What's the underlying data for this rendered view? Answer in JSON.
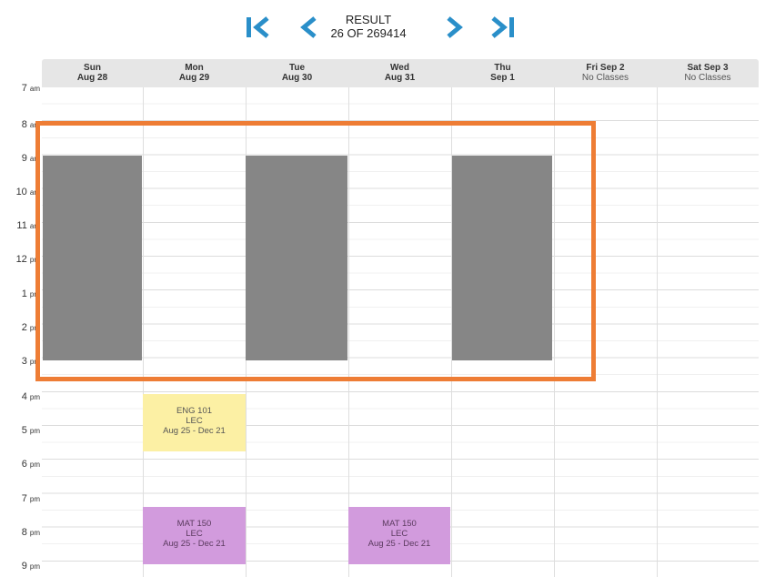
{
  "nav": {
    "first_label": "First result",
    "prev_label": "Previous result",
    "next_label": "Next result",
    "last_label": "Last result",
    "result_title": "RESULT",
    "result_count": "26 OF 269414",
    "icon_color": "#2a8fc9"
  },
  "days": [
    {
      "name": "Sun",
      "date": "Aug 28"
    },
    {
      "name": "Mon",
      "date": "Aug 29"
    },
    {
      "name": "Tue",
      "date": "Aug 30"
    },
    {
      "name": "Wed",
      "date": "Aug 31"
    },
    {
      "name": "Thu",
      "date": "Sep 1"
    },
    {
      "name": "Fri Sep 2",
      "date": "No Classes"
    },
    {
      "name": "Sat Sep 3",
      "date": "No Classes"
    }
  ],
  "times": [
    {
      "h": "7",
      "ap": "am"
    },
    {
      "h": "8",
      "ap": "am"
    },
    {
      "h": "9",
      "ap": "am"
    },
    {
      "h": "10",
      "ap": "am"
    },
    {
      "h": "11",
      "ap": "am"
    },
    {
      "h": "12",
      "ap": "pm"
    },
    {
      "h": "1",
      "ap": "pm"
    },
    {
      "h": "2",
      "ap": "pm"
    },
    {
      "h": "3",
      "ap": "pm"
    },
    {
      "h": "4",
      "ap": "pm"
    },
    {
      "h": "5",
      "ap": "pm"
    },
    {
      "h": "6",
      "ap": "pm"
    },
    {
      "h": "7",
      "ap": "pm"
    },
    {
      "h": "8",
      "ap": "pm"
    },
    {
      "h": "9",
      "ap": "pm"
    }
  ],
  "blocked": [
    {
      "day": "Sun",
      "start": "9:00 am",
      "end": "3:00 pm"
    },
    {
      "day": "Tue",
      "start": "9:00 am",
      "end": "3:00 pm"
    },
    {
      "day": "Thu",
      "start": "9:00 am",
      "end": "3:00 pm"
    }
  ],
  "events": [
    {
      "course": "ENG 101",
      "type": "LEC",
      "dates": "Aug 25 - Dec 21",
      "day": "Mon",
      "start": "4:00 pm",
      "end": "5:40 pm",
      "color": "yellow"
    },
    {
      "course": "MAT 150",
      "type": "LEC",
      "dates": "Aug 25 - Dec 21",
      "day": "Mon",
      "start": "7:20 pm",
      "end": "9:00 pm",
      "color": "purple"
    },
    {
      "course": "MAT 150",
      "type": "LEC",
      "dates": "Aug 25 - Dec 21",
      "day": "Wed",
      "start": "7:20 pm",
      "end": "9:00 pm",
      "color": "purple"
    }
  ],
  "colors": {
    "highlight": "#ee7d35",
    "blocked": "#868686",
    "event_yellow": "#fcf0a4",
    "event_purple": "#d29bdd",
    "header_bg": "#e6e6e6"
  }
}
